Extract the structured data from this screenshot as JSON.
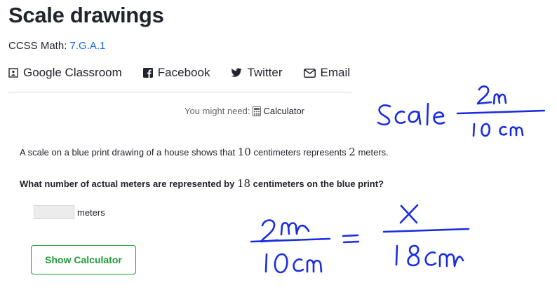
{
  "page": {
    "title": "Scale drawings",
    "ccss_prefix": "CCSS Math: ",
    "ccss_code": "7.G.A.1"
  },
  "share": {
    "classroom": "Google Classroom",
    "facebook": "Facebook",
    "twitter": "Twitter",
    "email": "Email"
  },
  "tools": {
    "might_need": "You might need:",
    "calculator": "Calculator"
  },
  "question": {
    "text_a": "A scale on a blue print drawing of a house shows that ",
    "n1": "10",
    "text_b": " centimeters represents ",
    "n2": "2",
    "text_c": " meters.",
    "ask_a": "What number of actual meters are represented by ",
    "n3": "18",
    "ask_b": " centimeters on the blue print?"
  },
  "answer": {
    "value": "",
    "unit": "meters"
  },
  "buttons": {
    "show_calculator": "Show Calculator"
  },
  "icons": {
    "classroom": "google-classroom-icon",
    "facebook": "facebook-icon",
    "twitter": "twitter-icon",
    "email": "envelope-icon",
    "calculator": "calculator-icon"
  },
  "annotations": {
    "scale_word": "Scale",
    "scale_num": "2m",
    "scale_den": "10 cm",
    "eq_left_num": "2m",
    "eq_left_den": "10cm",
    "eq_right_num": "x",
    "eq_right_den": "18cm"
  },
  "colors": {
    "link": "#1865f2",
    "button_green": "#1f9b3a",
    "ink": "#1a2ee0"
  }
}
